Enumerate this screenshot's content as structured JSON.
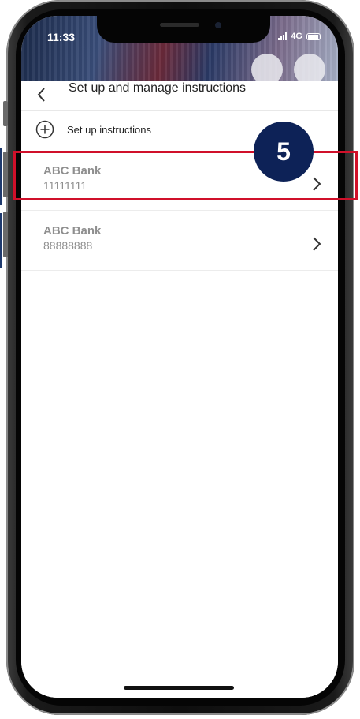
{
  "status_bar": {
    "time": "11:33",
    "network": "4G"
  },
  "header": {
    "title": "Set up and manage instructions"
  },
  "setup": {
    "label": "Set up instructions"
  },
  "accounts": [
    {
      "bank": "ABC Bank",
      "number": "11111111"
    },
    {
      "bank": "ABC Bank",
      "number": "88888888"
    }
  ],
  "annotation": {
    "step": "5"
  },
  "colors": {
    "highlight": "#d0102a",
    "badge": "#0d2257",
    "muted_text": "#8f8f8f"
  },
  "icons": [
    "back-chevron-icon",
    "plus-circle-icon",
    "chevron-right-icon",
    "signal-icon",
    "battery-icon"
  ]
}
